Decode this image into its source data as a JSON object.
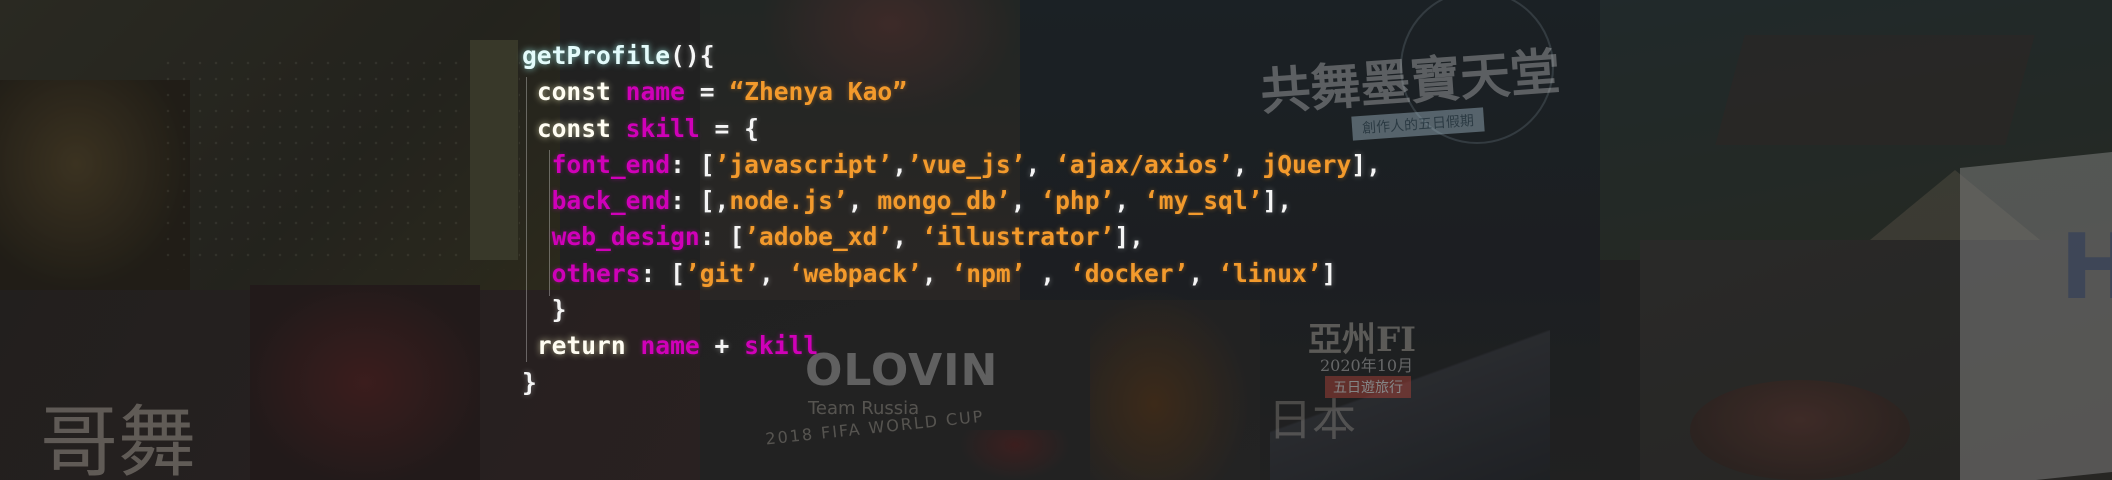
{
  "background_text": {
    "hero_title": "共舞墨寶天堂",
    "hero_subtitle": "創作人的五日假期",
    "team_title": "OLOVIN",
    "team_sub": "Team Russia",
    "world_cup": "2018 FIFA WORLD CUP",
    "asia_title": "亞州FI",
    "asia_date": "2020年10月",
    "asia_sub": "五日遊旅行",
    "japan_text": "日本",
    "brush_text": "哥舞",
    "side_letter": "H"
  },
  "code": {
    "l1": {
      "fn": "getProfile",
      "p": "(){"
    },
    "l2": {
      "kw": "const",
      "var": "name",
      "op": " = ",
      "str": "“Zhenya Kao”"
    },
    "l3": {
      "kw": "const",
      "var": "skill",
      "op": " = {"
    },
    "l4": {
      "prop": "font_end",
      "p1": ": [",
      "s1": "’javascript’",
      "p2": ",",
      "s2": "’vue_js’",
      "p3": ", ",
      "s3": "‘ajax/axios’",
      "p4": ", ",
      "s4": "jQuery",
      "p5": "],"
    },
    "l5": {
      "prop": "back_end",
      "p1": ": [,",
      "s1": "node.js’",
      "p2": ", ",
      "s2": "mongo_db’",
      "p3": ", ",
      "s3": "‘php’",
      "p4": ", ",
      "s4": "‘my_sql’",
      "p5": "],"
    },
    "l6": {
      "prop": "web_design",
      "p1": ": [",
      "s1": "’adobe_xd’",
      "p2": ", ",
      "s2": "‘illustrator’",
      "p3": "],"
    },
    "l7": {
      "prop": "others",
      "p1": ": [",
      "s1": "’git’",
      "p2": ", ",
      "s2": "‘webpack’",
      "p3": ", ",
      "s3": "‘npm’",
      "p4": " , ",
      "s4": "‘docker’",
      "p5": ", ",
      "s5": "‘linux’",
      "p6": "]"
    },
    "l8": {
      "p": "}"
    },
    "l9": {
      "kw": "return",
      "v1": "name",
      "op": " + ",
      "v2": "skill"
    },
    "l10": {
      "p": "}"
    }
  },
  "colors": {
    "function": "#e3fbfb",
    "keyword": "#fffdf2",
    "variable": "#d000b8",
    "string": "#f39a2c",
    "punctuation": "#f5f5f5"
  }
}
